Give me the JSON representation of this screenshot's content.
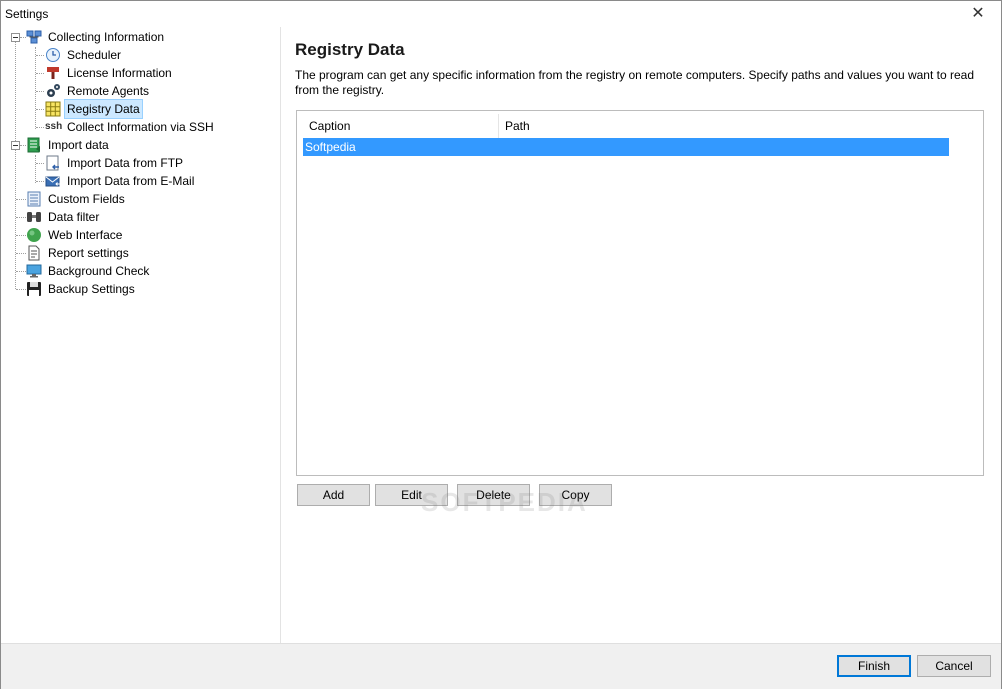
{
  "window": {
    "title": "Settings",
    "close_glyph": "✕"
  },
  "tree": {
    "items": [
      {
        "label": "Collecting Information",
        "icon": "network-computers-icon"
      },
      {
        "label": "Scheduler",
        "icon": "clock-icon"
      },
      {
        "label": "License Information",
        "icon": "license-stamp-icon"
      },
      {
        "label": "Remote Agents",
        "icon": "gears-icon"
      },
      {
        "label": "Registry Data",
        "icon": "grid-table-icon",
        "selected": true
      },
      {
        "label": "Collect Information via SSH",
        "icon": "ssh-text-icon",
        "glyph": "ssh"
      },
      {
        "label": "Import data",
        "icon": "import-data-icon"
      },
      {
        "label": "Import Data from FTP",
        "icon": "ftp-import-icon"
      },
      {
        "label": "Import Data from E-Mail",
        "icon": "email-import-icon"
      },
      {
        "label": "Custom Fields",
        "icon": "list-document-icon"
      },
      {
        "label": "Data filter",
        "icon": "binoculars-icon"
      },
      {
        "label": "Web Interface",
        "icon": "globe-icon"
      },
      {
        "label": "Report settings",
        "icon": "report-document-icon"
      },
      {
        "label": "Background Check",
        "icon": "monitor-icon"
      },
      {
        "label": "Backup Settings",
        "icon": "floppy-disk-icon"
      }
    ]
  },
  "content": {
    "title": "Registry Data",
    "description": "The program can get any specific information from the registry on remote computers. Specify paths and values you want to read from the registry.",
    "table": {
      "columns": [
        "Caption",
        "Path"
      ],
      "rows": [
        {
          "caption": "Softpedia",
          "path": ""
        }
      ]
    },
    "buttons": {
      "add": "Add",
      "edit": "Edit",
      "delete": "Delete",
      "copy": "Copy"
    }
  },
  "footer": {
    "finish": "Finish",
    "cancel": "Cancel"
  },
  "watermark": "SOFTPEDIA",
  "colors": {
    "selection": "#3399ff",
    "tree_selection": "#cce8ff",
    "accent": "#0078d7"
  }
}
